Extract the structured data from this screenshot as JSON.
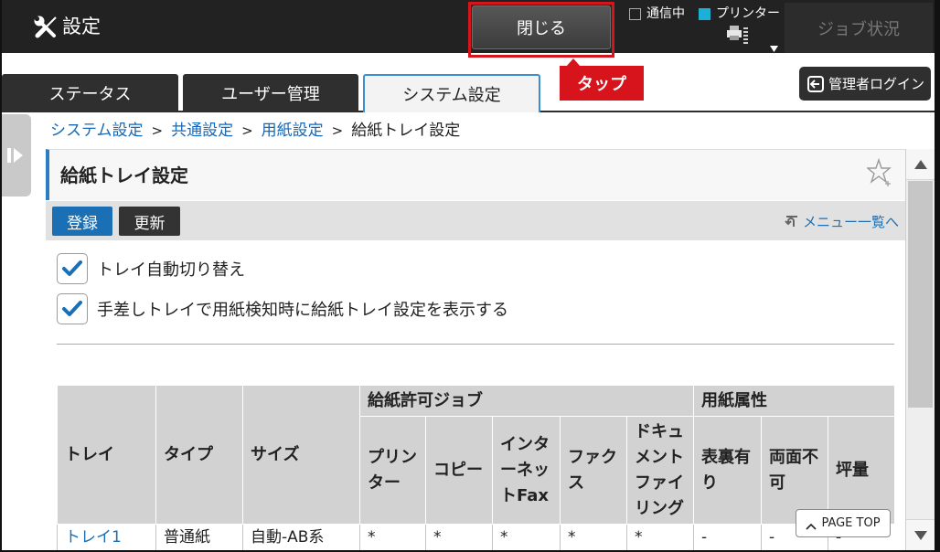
{
  "app": {
    "title": "設定"
  },
  "header": {
    "close_label": "閉じる",
    "status": [
      {
        "label": "通信中",
        "active": false
      },
      {
        "label": "プリンター",
        "active": true
      }
    ],
    "job_status_label": "ジョブ状況"
  },
  "annotation": {
    "callout_label": "タップ"
  },
  "tabs": [
    {
      "label": "ステータス",
      "active": false
    },
    {
      "label": "ユーザー管理",
      "active": false
    },
    {
      "label": "システム設定",
      "active": true
    }
  ],
  "admin_login_label": "管理者ログイン",
  "breadcrumb": {
    "separator": ">",
    "items": [
      {
        "label": "システム設定",
        "link": true
      },
      {
        "label": "共通設定",
        "link": true
      },
      {
        "label": "用紙設定",
        "link": true
      },
      {
        "label": "給紙トレイ設定",
        "link": false
      }
    ]
  },
  "page": {
    "title": "給紙トレイ設定"
  },
  "toolbar": {
    "register_label": "登録",
    "update_label": "更新",
    "menu_link_label": "メニュー一覧へ"
  },
  "options": [
    {
      "label": "トレイ自動切り替え",
      "checked": true
    },
    {
      "label": "手差しトレイで用紙検知時に給紙トレイ設定を表示する",
      "checked": true
    }
  ],
  "table": {
    "headers": {
      "tray": "トレイ",
      "type": "タイプ",
      "size": "サイズ",
      "allowed_jobs": "給紙許可ジョブ",
      "paper_attributes": "用紙属性"
    },
    "job_headers": [
      "プリンター",
      "コピー",
      "インターネットFax",
      "ファクス",
      "ドキュメントファイリング"
    ],
    "attribute_headers": [
      "表裏有り",
      "両面不可",
      "坪量"
    ],
    "rows": [
      {
        "tray": "トレイ1",
        "type": "普通紙",
        "size": "自動-AB系",
        "jobs": [
          "*",
          "*",
          "*",
          "*",
          "*"
        ],
        "attributes": [
          "-",
          "-",
          "-"
        ]
      }
    ]
  },
  "page_top_label": "PAGE TOP",
  "icons": {
    "app": "tools-icon",
    "comm_status": "checkbox-empty-icon",
    "printer_status": "status-square-icon",
    "printer": "printer-icon",
    "printer_menu": "dropdown-arrow-icon",
    "admin_login": "login-icon",
    "sidebar": "sidebar-expand-icon",
    "favorite": "star-icon",
    "menu_link": "return-icon",
    "option_check": "check-icon",
    "page_top": "chevron-up-icon",
    "scroll_up": "scroll-up-arrow-icon",
    "scroll_down": "scroll-down-arrow-icon"
  },
  "colors": {
    "top_bar": "#222222",
    "accent": "#1a6fb5",
    "annotation": "#d7141c",
    "printer_indicator": "#1bb0d8",
    "table_header": "#d2d2d2"
  }
}
